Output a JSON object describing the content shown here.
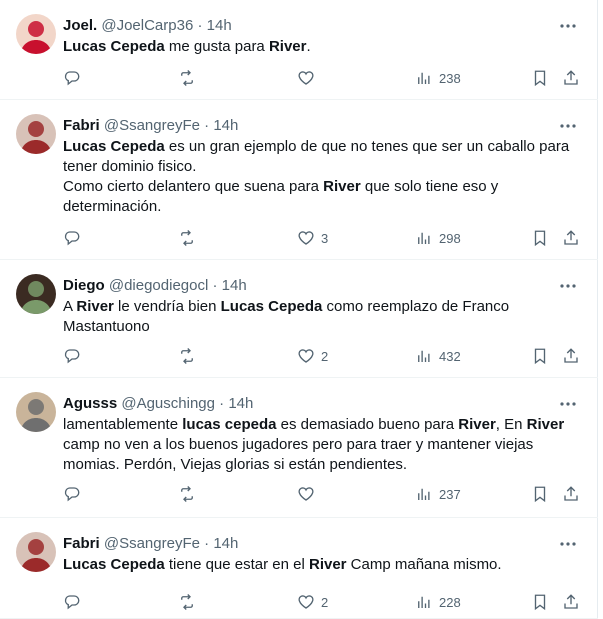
{
  "tweets": [
    {
      "name": "Joel.",
      "handle": "@JoelCarp36",
      "time": "14h",
      "lines": [
        [
          {
            "t": "Lucas Cepeda",
            "b": true
          },
          {
            "t": " me gusta para "
          },
          {
            "t": "River",
            "b": true
          },
          {
            "t": "."
          }
        ]
      ],
      "replies": "",
      "retweets": "",
      "likes": "",
      "views": "238"
    },
    {
      "name": "Fabri",
      "handle": "@SsangreyFe",
      "time": "14h",
      "lines": [
        [
          {
            "t": "Lucas Cepeda",
            "b": true
          },
          {
            "t": " es un gran ejemplo de que no tenes que ser un caballo para"
          }
        ],
        [
          {
            "t": "tener dominio fisico."
          }
        ],
        [
          {
            "t": "Como cierto delantero que suena para "
          },
          {
            "t": "River",
            "b": true
          },
          {
            "t": " que solo tiene eso y"
          }
        ],
        [
          {
            "t": "determinación."
          }
        ]
      ],
      "replies": "",
      "retweets": "",
      "likes": "3",
      "views": "298"
    },
    {
      "name": "Diego",
      "handle": "@diegodiegocl",
      "time": "14h",
      "lines": [
        [
          {
            "t": "A "
          },
          {
            "t": "River",
            "b": true
          },
          {
            "t": " le vendría bien "
          },
          {
            "t": "Lucas Cepeda",
            "b": true
          },
          {
            "t": " como reemplazo de Franco"
          }
        ],
        [
          {
            "t": "Mastantuono"
          }
        ]
      ],
      "replies": "",
      "retweets": "",
      "likes": "2",
      "views": "432"
    },
    {
      "name": "Agusss",
      "handle": "@Aguschingg",
      "time": "14h",
      "lines": [
        [
          {
            "t": "lamentablemente "
          },
          {
            "t": "lucas cepeda",
            "b": true
          },
          {
            "t": " es demasiado bueno para "
          },
          {
            "t": "River",
            "b": true
          },
          {
            "t": ", En "
          },
          {
            "t": "River",
            "b": true
          }
        ],
        [
          {
            "t": "camp no ven a los buenos jugadores pero para traer y mantener viejas"
          }
        ],
        [
          {
            "t": "momias. Perdón, Viejas glorias si están pendientes."
          }
        ]
      ],
      "replies": "",
      "retweets": "",
      "likes": "",
      "views": "237"
    },
    {
      "name": "Fabri",
      "handle": "@SsangreyFe",
      "time": "14h",
      "lines": [
        [
          {
            "t": "Lucas Cepeda",
            "b": true
          },
          {
            "t": " tiene que estar en el "
          },
          {
            "t": "River",
            "b": true
          },
          {
            "t": " Camp mañana mismo."
          }
        ]
      ],
      "replies": "",
      "retweets": "",
      "likes": "2",
      "views": "228"
    }
  ],
  "icons": {
    "reply": "reply-icon",
    "retweet": "retweet-icon",
    "like": "heart-icon",
    "views": "views-icon",
    "bookmark": "bookmark-icon",
    "share": "share-icon",
    "more": "more-icon"
  },
  "colors": {
    "text": "#0f1419",
    "muted": "#536471",
    "divider": "#eff3f4"
  }
}
